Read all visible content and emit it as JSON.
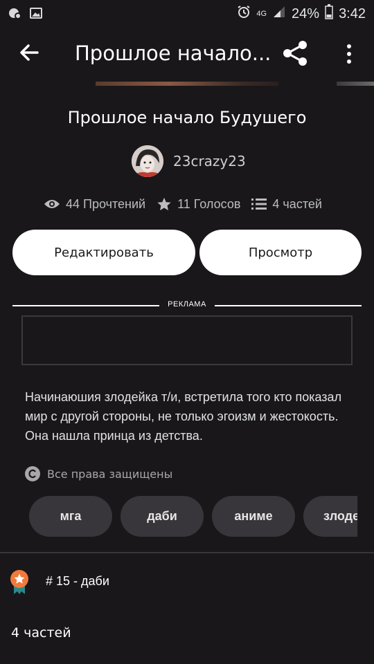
{
  "status_bar": {
    "battery": "24%",
    "time": "3:42",
    "network": "4G"
  },
  "app_bar": {
    "title": "Прошлое начало..."
  },
  "story": {
    "title": "Прошлое начало Будушего",
    "author": "23crazy23",
    "stats": {
      "reads": "44 Прочтений",
      "votes": "11 Голосов",
      "parts": "4 частей"
    }
  },
  "actions": {
    "edit_label": "Редактировать",
    "view_label": "Просмотр"
  },
  "ad": {
    "label": "РЕКЛАМА"
  },
  "description": "Начинаюшия злодейка т/и,  встретила того кто показал мир с другой стороны, не только эгоизм и жестокость. Она нашла принца из детства.",
  "rights": "Все права защищены",
  "tags": [
    "мга",
    "даби",
    "аниме",
    "злодейка"
  ],
  "ranking": "# 15 - даби",
  "parts_section": {
    "title": "4 частей"
  },
  "colors": {
    "background": "#19171a",
    "button": "#ffffff",
    "tag_bg": "#38363a",
    "rank_badge": "#f07a3a",
    "rank_ribbon": "#2a8a8a"
  }
}
